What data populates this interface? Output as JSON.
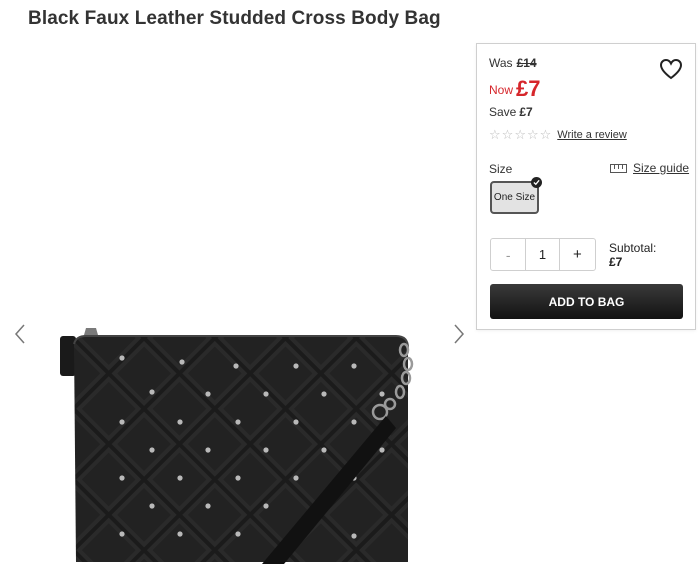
{
  "product": {
    "title": "Black Faux Leather Studded Cross Body Bag"
  },
  "gallery": {
    "prev_icon": "chevron-left-icon",
    "next_icon": "chevron-right-icon",
    "image": "black-quilted-studded-bag-photo"
  },
  "pricing": {
    "was_label": "Was",
    "was_price": "£14",
    "now_label": "Now",
    "now_price": "£7",
    "save_label": "Save",
    "save_amount": "£7",
    "accent_color": "#d6262b"
  },
  "wishlist": {
    "icon": "heart-icon"
  },
  "rating": {
    "stars": 0,
    "max_stars": 5,
    "review_link": "Write a review"
  },
  "size": {
    "label": "Size",
    "guide_label": "Size guide",
    "guide_icon": "ruler-icon",
    "options": [
      "One Size"
    ],
    "selected": "One Size"
  },
  "quantity": {
    "minus": "-",
    "value": "1",
    "plus": "+"
  },
  "subtotal": {
    "label": "Subtotal:",
    "amount": "£7"
  },
  "cta": {
    "label": "ADD TO BAG"
  }
}
